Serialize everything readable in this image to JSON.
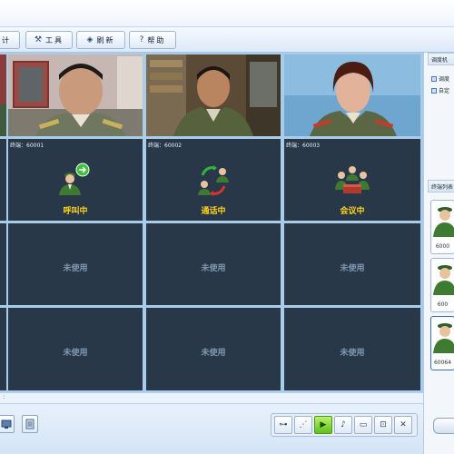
{
  "toolbar": {
    "buttons": [
      {
        "label": "计",
        "icon": "statistics-icon"
      },
      {
        "label": "工具",
        "icon": "tools-icon"
      },
      {
        "label": "刷新",
        "icon": "refresh-icon"
      },
      {
        "label": "帮助",
        "icon": "help-icon"
      }
    ]
  },
  "grid": {
    "row2": [
      {
        "caption": "终端：60001",
        "state": "呼叫中"
      },
      {
        "caption": "终端：60002",
        "state": "通话中"
      },
      {
        "caption": "终端：60003",
        "state": "会议中"
      }
    ],
    "unused_label": "未使用"
  },
  "right_panel": {
    "header1": "调度机",
    "items": [
      "调度",
      "自定"
    ],
    "header2": "终端列表",
    "thumbs": [
      {
        "label": "6000"
      },
      {
        "label": "600"
      },
      {
        "label": "60064"
      }
    ]
  },
  "statusline": {
    "text": ":"
  },
  "colors": {
    "cell_bg": "#283848",
    "grid_line": "#a9cde8",
    "state_text": "#ffd21a",
    "unused_text": "#7e97b0",
    "play_active": "#5fbf1d"
  }
}
